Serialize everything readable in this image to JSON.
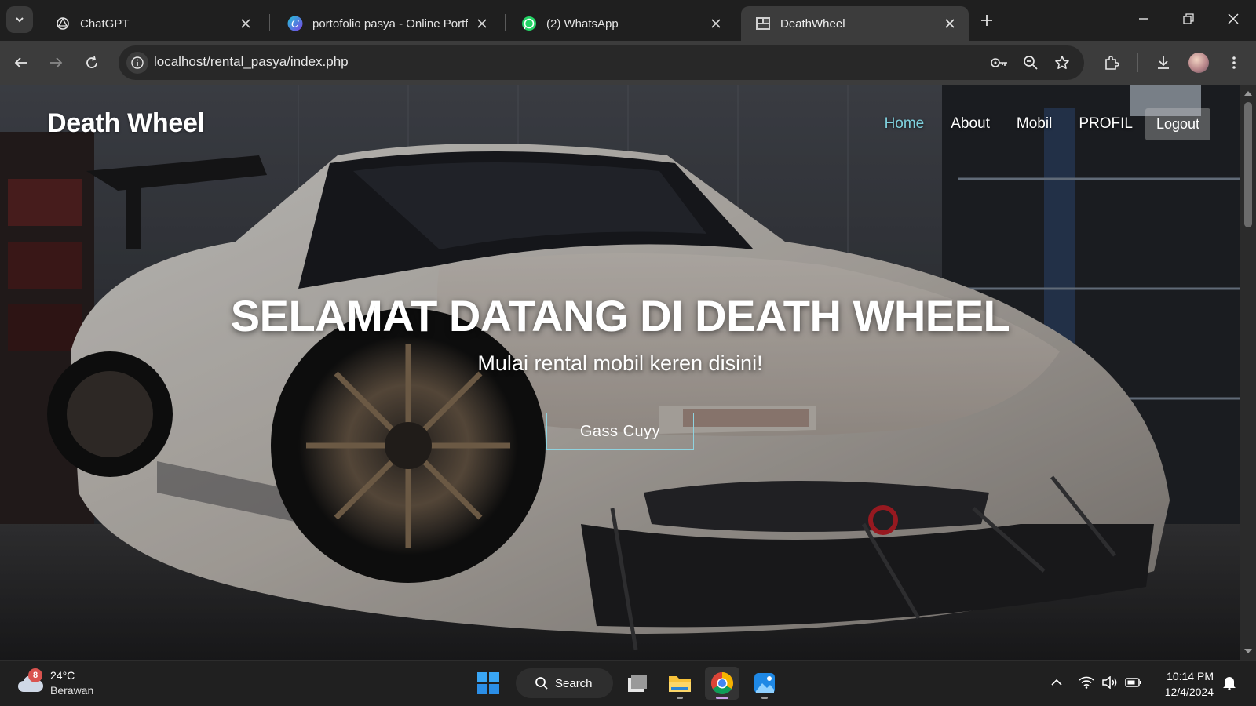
{
  "browser": {
    "tabs": [
      {
        "title": "ChatGPT",
        "icon": "chatgpt-icon"
      },
      {
        "title": "portofolio pasya - Online Portfolio",
        "icon": "canva-icon"
      },
      {
        "title": "(2) WhatsApp",
        "icon": "whatsapp-icon"
      },
      {
        "title": "DeathWheel",
        "icon": "site-favicon",
        "active": true
      }
    ],
    "url": "localhost/rental_pasya/index.php"
  },
  "site": {
    "brand": "Death Wheel",
    "nav": {
      "home": "Home",
      "about": "About",
      "mobil": "Mobil",
      "profil": "PROFIL",
      "logout": "Logout"
    },
    "hero": {
      "title": "SELAMAT DATANG DI DEATH WHEEL",
      "subtitle": "Mulai rental mobil keren disini!",
      "cta": "Gass Cuyy"
    },
    "accent_color": "#7fd1de"
  },
  "taskbar": {
    "weather": {
      "temp": "24°C",
      "condition": "Berawan",
      "badge": "8"
    },
    "search_label": "Search",
    "time": "10:14 PM",
    "date": "12/4/2024"
  }
}
